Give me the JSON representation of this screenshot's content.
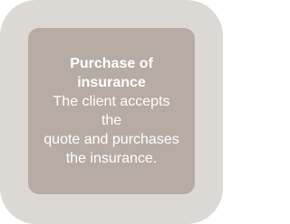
{
  "card": {
    "title": "Purchase of insurance",
    "description_lines": [
      "The client accepts",
      "the",
      "quote and purchases",
      "the insurance."
    ]
  },
  "colors": {
    "outer_frame": "#dcd8d4",
    "inner_box": "#b6aca4",
    "text": "#ffffff"
  }
}
